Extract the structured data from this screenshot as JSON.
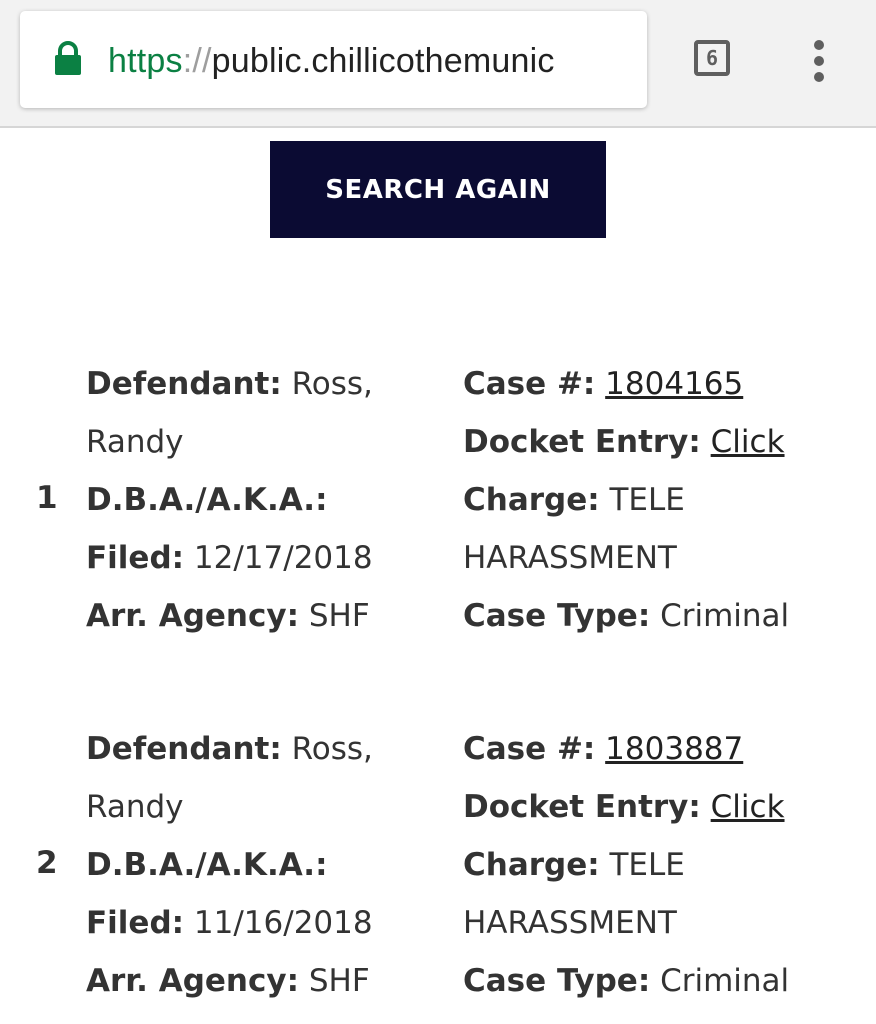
{
  "browser": {
    "url_scheme": "https",
    "url_sep": "://",
    "url_host": "public.chillicothemunic",
    "tab_count": "6"
  },
  "search_again_label": "SEARCH AGAIN",
  "results": [
    {
      "index": "1",
      "defendant_label": "Defendant:",
      "defendant_value_1": "Ross,",
      "defendant_value_2": "Randy",
      "dba_label": "D.B.A./A.K.A.:",
      "filed_label": "Filed:",
      "filed_value": "12/17/2018",
      "agency_label": "Arr. Agency:",
      "agency_value": "SHF",
      "case_label": "Case #:",
      "case_value": "1804165",
      "docket_label": "Docket Entry:",
      "docket_value": "Click",
      "charge_label": "Charge:",
      "charge_value_1": "TELE",
      "charge_value_2": "HARASSMENT",
      "case_type_label": "Case Type:",
      "case_type_value": "Criminal"
    },
    {
      "index": "2",
      "defendant_label": "Defendant:",
      "defendant_value_1": "Ross,",
      "defendant_value_2": "Randy",
      "dba_label": "D.B.A./A.K.A.:",
      "filed_label": "Filed:",
      "filed_value": "11/16/2018",
      "agency_label": "Arr. Agency:",
      "agency_value": "SHF",
      "case_label": "Case #:",
      "case_value": "1803887",
      "docket_label": "Docket Entry:",
      "docket_value": "Click",
      "charge_label": "Charge:",
      "charge_value_1": "TELE",
      "charge_value_2": "HARASSMENT",
      "case_type_label": "Case Type:",
      "case_type_value": "Criminal"
    }
  ],
  "colors": {
    "button_bg": "#0b0b33",
    "secure_green": "#0b8043",
    "text": "#333333"
  }
}
